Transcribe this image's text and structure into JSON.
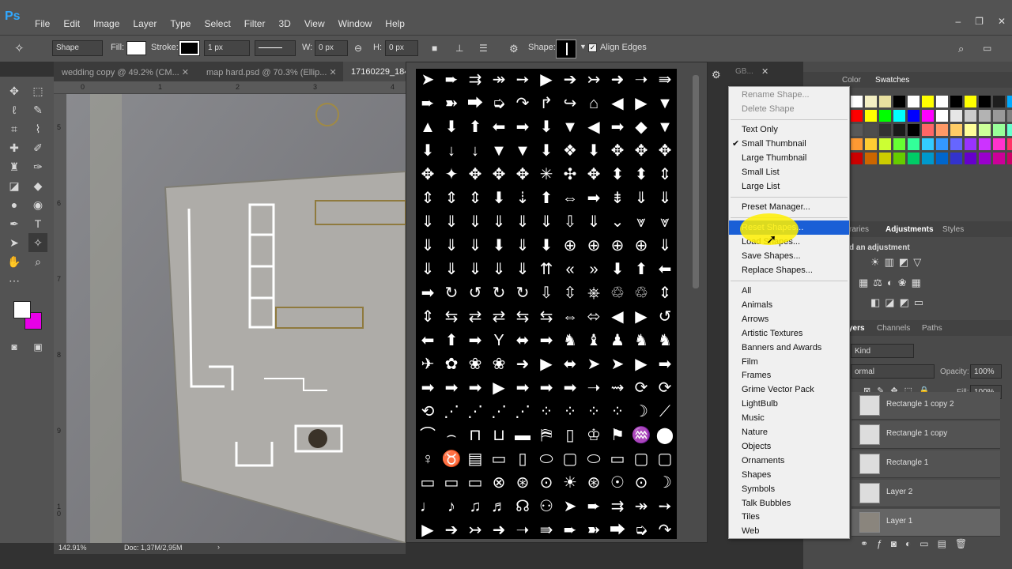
{
  "app": {
    "logo": "Ps"
  },
  "menu": [
    "File",
    "Edit",
    "Image",
    "Layer",
    "Type",
    "Select",
    "Filter",
    "3D",
    "View",
    "Window",
    "Help"
  ],
  "options": {
    "mode": "Shape",
    "fill_label": "Fill:",
    "stroke_label": "Stroke:",
    "stroke_width": "1 px",
    "w_label": "W:",
    "w_value": "0 px",
    "h_label": "H:",
    "h_value": "0 px",
    "shape_label": "Shape:",
    "align_edges": "Align Edges"
  },
  "tabs": [
    "wedding copy @ 49.2% (CM...",
    "map hard.psd @ 70.3% (Ellip...",
    "17160229_184"
  ],
  "tab_extra": "GB...",
  "ruler_top": [
    "0",
    "1",
    "2",
    "3",
    "4"
  ],
  "ruler_left": [
    "5",
    "6",
    "7",
    "8",
    "9",
    "1\n0"
  ],
  "status": {
    "zoom": "142.91%",
    "doc": "Doc: 1,37M/2,95M"
  },
  "menu_items": {
    "rename": "Rename Shape...",
    "delete": "Delete Shape",
    "text_only": "Text Only",
    "small_thumb": "Small Thumbnail",
    "large_thumb": "Large Thumbnail",
    "small_list": "Small List",
    "large_list": "Large List",
    "preset_manager": "Preset Manager...",
    "reset": "Reset Shapes...",
    "load": "Load Shapes...",
    "save": "Save Shapes...",
    "replace": "Replace Shapes...",
    "sets": [
      "All",
      "Animals",
      "Arrows",
      "Artistic Textures",
      "Banners and Awards",
      "Film",
      "Frames",
      "Grime Vector Pack",
      "LightBulb",
      "Music",
      "Nature",
      "Objects",
      "Ornaments",
      "Shapes",
      "Symbols",
      "Talk Bubbles",
      "Tiles",
      "Web"
    ]
  },
  "panels": {
    "color_tab": "Color",
    "swatches_tab": "Swatches",
    "libraries_tab": "raries",
    "adjustments_tab": "Adjustments",
    "styles_tab": "Styles",
    "add_adjustment": "d an adjustment",
    "layers_tab": "yers",
    "channels_tab": "Channels",
    "paths_tab": "Paths",
    "kind": "Kind",
    "blend": "ormal",
    "opacity_label": "Opacity:",
    "opacity_value": "100%",
    "fill_label": "Fill:",
    "fill_value": "100%",
    "layers": [
      "Rectangle 1 copy 2",
      "Rectangle 1 copy",
      "Rectangle 1",
      "Layer 2",
      "Layer 1"
    ]
  },
  "colors": {
    "foreground": "#ffffff",
    "background": "#e800e8",
    "highlight": "#1a5fd6"
  }
}
